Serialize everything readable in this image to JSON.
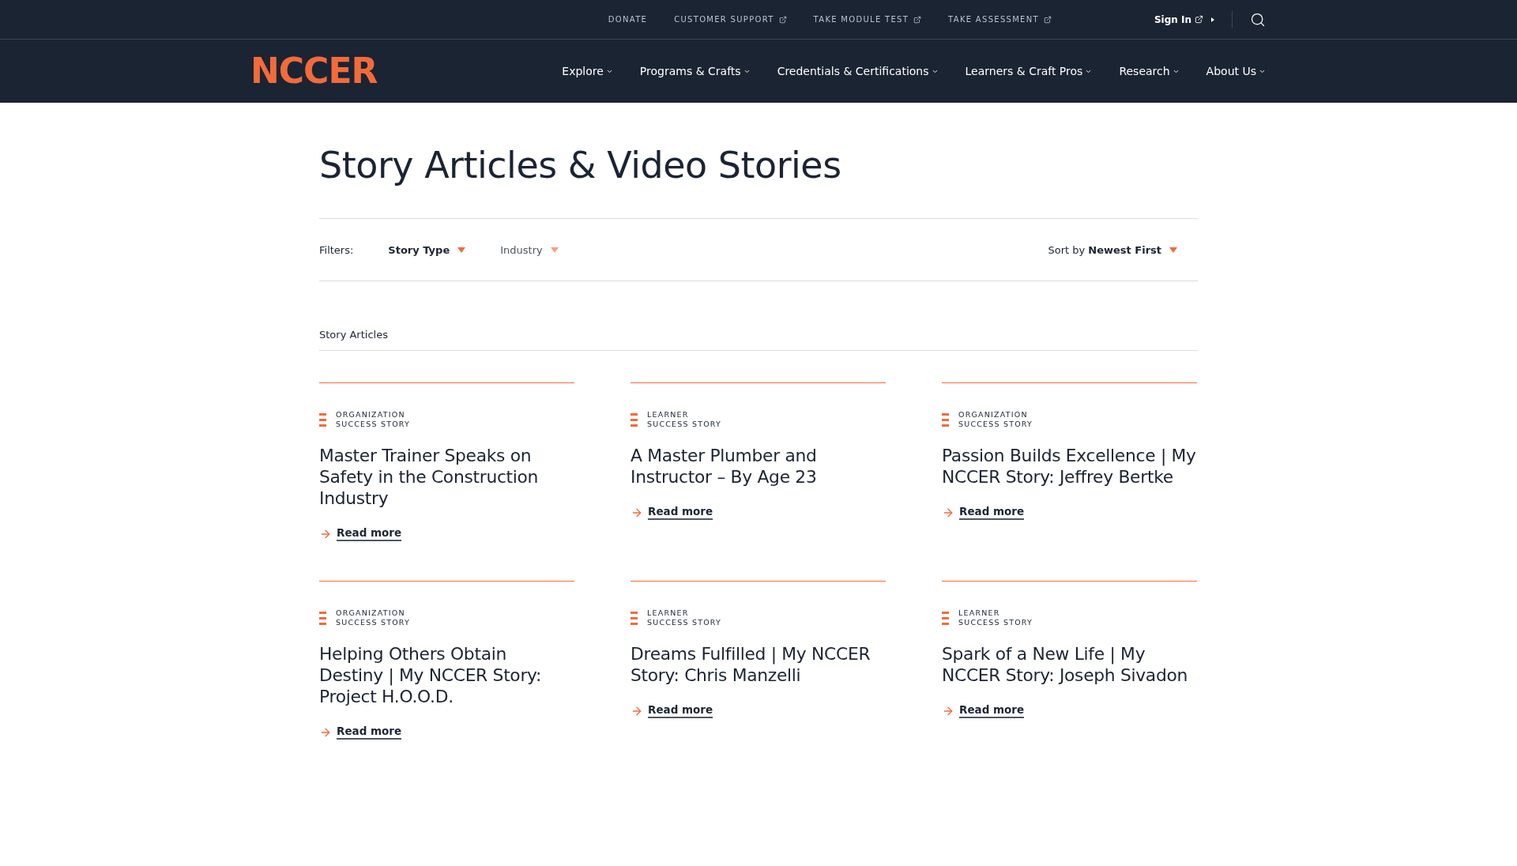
{
  "top_links": [
    {
      "label": "DONATE",
      "external": false
    },
    {
      "label": "CUSTOMER SUPPORT",
      "external": true
    },
    {
      "label": "TAKE MODULE TEST",
      "external": true
    },
    {
      "label": "TAKE ASSESSMENT",
      "external": true
    }
  ],
  "sign_in": {
    "label": "Sign In",
    "external": true
  },
  "logo": "NCCER",
  "nav": [
    {
      "label": "Explore"
    },
    {
      "label": "Programs & Crafts"
    },
    {
      "label": "Credentials & Certifications"
    },
    {
      "label": "Learners & Craft Pros"
    },
    {
      "label": "Research"
    },
    {
      "label": "About Us"
    }
  ],
  "page_title": "Story Articles & Video Stories",
  "filters": {
    "label": "Filters:",
    "items": [
      {
        "label": "Story Type",
        "active": true
      },
      {
        "label": "Industry",
        "active": false
      }
    ],
    "sort_prefix": "Sort by",
    "sort_value": "Newest First"
  },
  "section_title": "Story Articles",
  "articles": [
    {
      "category": [
        "ORGANIZATION",
        "SUCCESS STORY"
      ],
      "title": "Master Trainer Speaks on Safety in the Construction Industry",
      "link": "Read more"
    },
    {
      "category": [
        "LEARNER",
        "SUCCESS STORY"
      ],
      "title": "A Master Plumber and Instructor – By Age 23",
      "link": "Read more"
    },
    {
      "category": [
        "ORGANIZATION",
        "SUCCESS STORY"
      ],
      "title": "Passion Builds Excellence | My NCCER Story: Jeffrey Bertke",
      "link": "Read more"
    },
    {
      "category": [
        "ORGANIZATION",
        "SUCCESS STORY"
      ],
      "title": "Helping Others Obtain Destiny | My NCCER Story: Project H.O.O.D.",
      "link": "Read more"
    },
    {
      "category": [
        "LEARNER",
        "SUCCESS STORY"
      ],
      "title": "Dreams Fulfilled | My NCCER Story: Chris Manzelli",
      "link": "Read more"
    },
    {
      "category": [
        "LEARNER",
        "SUCCESS STORY"
      ],
      "title": "Spark of a New Life | My NCCER Story: Joseph Sivadon",
      "link": "Read more"
    }
  ]
}
